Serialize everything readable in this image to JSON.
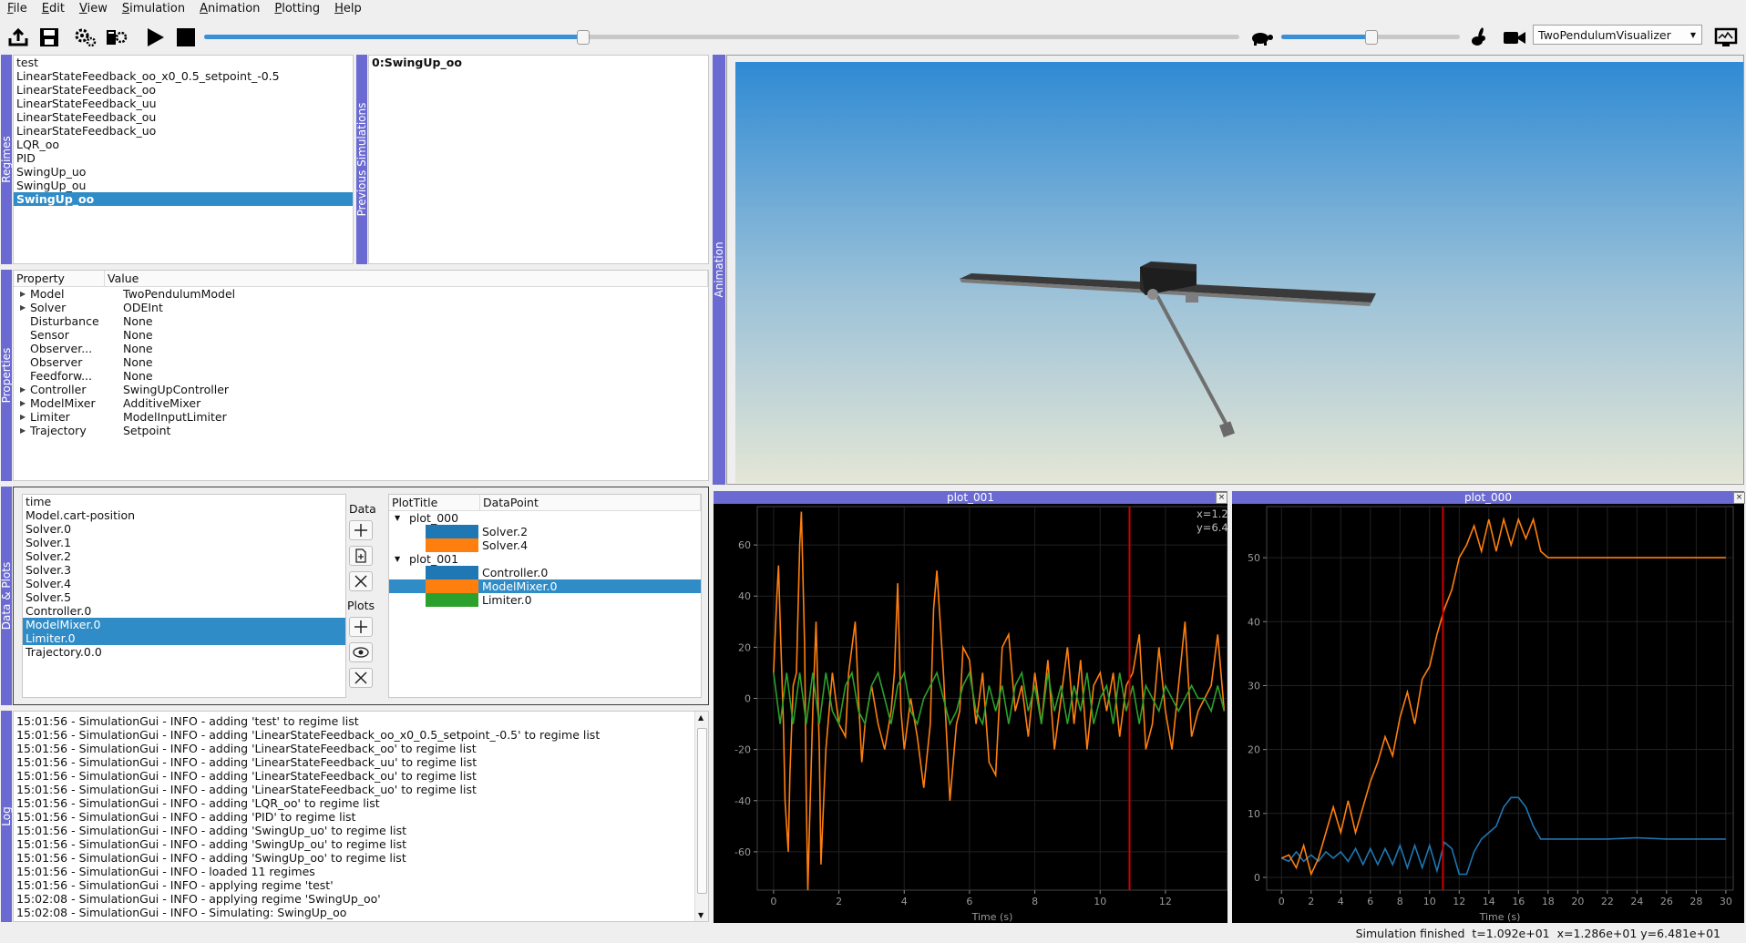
{
  "menu": [
    "File",
    "Edit",
    "View",
    "Simulation",
    "Animation",
    "Plotting",
    "Help"
  ],
  "toolbar": {
    "icons": [
      "upload-icon",
      "save-icon",
      "settings-icon",
      "batch-settings-icon",
      "play-icon",
      "stop-icon",
      "turtle-icon",
      "rabbit-icon",
      "camera-icon",
      "monitor-icon"
    ],
    "progress_fraction": 0.365,
    "speed_fraction": 0.5,
    "visualizer": "TwoPendulumVisualizer"
  },
  "docks": {
    "regimes": "Regimes",
    "previous": "Previous Simulations",
    "properties": "Properties",
    "data_plots": "Data & Plots",
    "log": "Log",
    "animation": "Animation"
  },
  "regimes": [
    "test",
    "LinearStateFeedback_oo_x0_0.5_setpoint_-0.5",
    "LinearStateFeedback_oo",
    "LinearStateFeedback_uu",
    "LinearStateFeedback_ou",
    "LinearStateFeedback_uo",
    "LQR_oo",
    "PID",
    "SwingUp_uo",
    "SwingUp_ou",
    "SwingUp_oo"
  ],
  "regimes_selected": 10,
  "previous_simulations": [
    "0:SwingUp_oo"
  ],
  "properties": {
    "headers": [
      "Property",
      "Value"
    ],
    "rows": [
      {
        "k": "Model",
        "v": "TwoPendulumModel",
        "exp": true
      },
      {
        "k": "Solver",
        "v": "ODEInt",
        "exp": true
      },
      {
        "k": "Disturbance",
        "v": "None",
        "exp": false
      },
      {
        "k": "Sensor",
        "v": "None",
        "exp": false
      },
      {
        "k": "Observer...",
        "v": "None",
        "exp": false
      },
      {
        "k": "Observer",
        "v": "None",
        "exp": false
      },
      {
        "k": "Feedforw...",
        "v": "None",
        "exp": false
      },
      {
        "k": "Controller",
        "v": "SwingUpController",
        "exp": true
      },
      {
        "k": "ModelMixer",
        "v": "AdditiveMixer",
        "exp": true
      },
      {
        "k": "Limiter",
        "v": "ModelInputLimiter",
        "exp": true
      },
      {
        "k": "Trajectory",
        "v": "Setpoint",
        "exp": true
      }
    ]
  },
  "data_list": [
    "time",
    "Model.cart-position",
    "Solver.0",
    "Solver.1",
    "Solver.2",
    "Solver.3",
    "Solver.4",
    "Solver.5",
    "Controller.0",
    "ModelMixer.0",
    "Limiter.0",
    "Trajectory.0.0"
  ],
  "data_selected": [
    9,
    10
  ],
  "side": {
    "data": "Data",
    "plots": "Plots"
  },
  "plot_tree": {
    "headers": [
      "PlotTitle",
      "DataPoint"
    ],
    "groups": [
      {
        "title": "plot_000",
        "items": [
          {
            "name": "Solver.2",
            "color": "#1f77b4"
          },
          {
            "name": "Solver.4",
            "color": "#ff7f0e"
          }
        ]
      },
      {
        "title": "plot_001",
        "items": [
          {
            "name": "Controller.0",
            "color": "#1f77b4"
          },
          {
            "name": "ModelMixer.0",
            "color": "#ff7f0e",
            "selected": true
          },
          {
            "name": "Limiter.0",
            "color": "#2ca02c"
          }
        ]
      }
    ]
  },
  "log": [
    "15:01:56 - SimulationGui - INFO - adding 'test' to regime list",
    "15:01:56 - SimulationGui - INFO - adding 'LinearStateFeedback_oo_x0_0.5_setpoint_-0.5' to regime list",
    "15:01:56 - SimulationGui - INFO - adding 'LinearStateFeedback_oo' to regime list",
    "15:01:56 - SimulationGui - INFO - adding 'LinearStateFeedback_uu' to regime list",
    "15:01:56 - SimulationGui - INFO - adding 'LinearStateFeedback_ou' to regime list",
    "15:01:56 - SimulationGui - INFO - adding 'LinearStateFeedback_uo' to regime list",
    "15:01:56 - SimulationGui - INFO - adding 'LQR_oo' to regime list",
    "15:01:56 - SimulationGui - INFO - adding 'PID' to regime list",
    "15:01:56 - SimulationGui - INFO - adding 'SwingUp_uo' to regime list",
    "15:01:56 - SimulationGui - INFO - adding 'SwingUp_ou' to regime list",
    "15:01:56 - SimulationGui - INFO - adding 'SwingUp_oo' to regime list",
    "15:01:56 - SimulationGui - INFO - loaded 11 regimes",
    "15:01:56 - SimulationGui - INFO - applying regime 'test'",
    "15:02:08 - SimulationGui - INFO - applying regime 'SwingUp_oo'",
    "15:02:08 - SimulationGui - INFO - Simulating: SwingUp_oo"
  ],
  "plots": {
    "p001": {
      "title": "plot_001",
      "coord_x": "x=1.2",
      "coord_y": "y=6.4"
    },
    "p000": {
      "title": "plot_000"
    }
  },
  "chart_data": [
    {
      "type": "line",
      "title": "plot_001",
      "xlabel": "Time (s)",
      "xlim": [
        -0.5,
        13.9
      ],
      "ylim": [
        -75,
        75
      ],
      "xticks": [
        0,
        2,
        4,
        6,
        8,
        10,
        12
      ],
      "yticks": [
        -60,
        -40,
        -20,
        0,
        20,
        40,
        60
      ],
      "cursor_x": 10.9,
      "series": [
        {
          "name": "ModelMixer.0",
          "color": "#ff7f0e",
          "x": [
            0,
            0.1,
            0.15,
            0.2,
            0.3,
            0.35,
            0.45,
            0.5,
            0.6,
            0.7,
            0.8,
            0.85,
            0.95,
            1.0,
            1.05,
            1.1,
            1.2,
            1.3,
            1.4,
            1.45,
            1.6,
            1.8,
            2.0,
            2.2,
            2.3,
            2.5,
            2.6,
            2.7,
            2.8,
            3.0,
            3.2,
            3.4,
            3.6,
            3.7,
            3.8,
            3.9,
            4.0,
            4.2,
            4.4,
            4.6,
            4.8,
            4.9,
            5.0,
            5.2,
            5.4,
            5.6,
            5.7,
            5.8,
            6.0,
            6.2,
            6.4,
            6.6,
            6.8,
            7.0,
            7.2,
            7.4,
            7.6,
            7.8,
            8.0,
            8.2,
            8.4,
            8.6,
            8.8,
            9.0,
            9.2,
            9.4,
            9.6,
            9.8,
            10.0,
            10.2,
            10.4,
            10.6,
            10.8,
            11.0,
            11.2,
            11.4,
            11.6,
            11.8,
            12.0,
            12.2,
            12.4,
            12.6,
            12.8,
            13.0,
            13.2,
            13.4,
            13.6,
            13.8
          ],
          "y": [
            10,
            40,
            52,
            30,
            -10,
            -40,
            -60,
            -30,
            5,
            10,
            60,
            73,
            20,
            -40,
            -75,
            -50,
            -5,
            30,
            -20,
            -65,
            -20,
            10,
            -10,
            -15,
            10,
            30,
            0,
            -25,
            -10,
            5,
            -10,
            -20,
            -5,
            10,
            45,
            -5,
            -20,
            0,
            -15,
            -35,
            -10,
            35,
            50,
            10,
            -40,
            -10,
            -5,
            20,
            15,
            -10,
            10,
            -25,
            -30,
            20,
            25,
            -5,
            5,
            -15,
            10,
            -10,
            15,
            -20,
            0,
            20,
            -10,
            15,
            -20,
            5,
            10,
            -5,
            10,
            -15,
            5,
            10,
            25,
            -20,
            -10,
            20,
            -5,
            -20,
            5,
            30,
            -15,
            -5,
            0,
            5,
            25,
            -5
          ]
        },
        {
          "name": "Limiter.0",
          "color": "#2ca02c",
          "x": [
            0,
            0.2,
            0.4,
            0.6,
            0.8,
            1.0,
            1.2,
            1.4,
            1.6,
            1.8,
            2.0,
            2.2,
            2.4,
            2.6,
            2.8,
            3.0,
            3.2,
            3.4,
            3.6,
            3.8,
            4.0,
            4.2,
            4.4,
            4.6,
            4.8,
            5.0,
            5.2,
            5.4,
            5.6,
            5.8,
            6.0,
            6.2,
            6.4,
            6.6,
            6.8,
            7.0,
            7.2,
            7.4,
            7.6,
            7.8,
            8.0,
            8.2,
            8.4,
            8.6,
            8.8,
            9.0,
            9.2,
            9.4,
            9.6,
            9.8,
            10.0,
            10.2,
            10.4,
            10.6,
            10.8,
            11.0,
            11.2,
            11.4,
            11.6,
            11.8,
            12.0,
            12.2,
            12.4,
            12.6,
            12.8,
            13.0,
            13.2,
            13.4,
            13.6,
            13.8
          ],
          "y": [
            10,
            -10,
            10,
            -10,
            10,
            -10,
            10,
            -10,
            10,
            -5,
            -10,
            5,
            10,
            -5,
            -10,
            5,
            10,
            0,
            -10,
            5,
            10,
            -5,
            -10,
            0,
            5,
            10,
            0,
            -10,
            -5,
            5,
            10,
            -5,
            -10,
            5,
            -5,
            5,
            -10,
            5,
            10,
            -5,
            5,
            -10,
            10,
            -5,
            5,
            -10,
            5,
            -5,
            10,
            -10,
            0,
            5,
            -10,
            10,
            -5,
            5,
            -10,
            5,
            0,
            -5,
            5,
            0,
            -5,
            0,
            5,
            0,
            0,
            -5,
            5,
            -5
          ]
        }
      ]
    },
    {
      "type": "line",
      "title": "plot_000",
      "xlabel": "Time (s)",
      "xlim": [
        -1,
        30.5
      ],
      "ylim": [
        -2,
        58
      ],
      "xticks": [
        0,
        2,
        4,
        6,
        8,
        10,
        12,
        14,
        16,
        18,
        20,
        22,
        24,
        26,
        28,
        30
      ],
      "yticks": [
        0,
        10,
        20,
        30,
        40,
        50
      ],
      "cursor_x": 10.9,
      "series": [
        {
          "name": "Solver.2",
          "color": "#1f77b4",
          "x": [
            0,
            0.5,
            1,
            1.5,
            2,
            2.5,
            3,
            3.5,
            4,
            4.5,
            5,
            5.5,
            6,
            6.5,
            7,
            7.5,
            8,
            8.5,
            9,
            9.5,
            10,
            10.5,
            11,
            11.5,
            12,
            12.5,
            13,
            13.5,
            14,
            14.5,
            15,
            15.5,
            16,
            16.5,
            17,
            17.5,
            18,
            19,
            20,
            22,
            24,
            26,
            28,
            30
          ],
          "y": [
            3,
            2.5,
            4,
            2.5,
            3.5,
            2.5,
            4,
            3,
            4,
            2.5,
            4.5,
            2,
            4.5,
            2,
            4.5,
            2,
            5,
            1.5,
            5,
            1.5,
            5,
            1,
            5.5,
            4.5,
            0.5,
            0.5,
            4,
            6,
            7,
            8,
            11,
            12.5,
            12.5,
            11,
            8,
            6,
            6,
            6,
            6,
            6,
            6.2,
            6,
            6,
            6
          ]
        },
        {
          "name": "Solver.4",
          "color": "#ff7f0e",
          "x": [
            0,
            0.5,
            1,
            1.5,
            2,
            2.5,
            3,
            3.5,
            4,
            4.5,
            5,
            5.5,
            6,
            6.5,
            7,
            7.5,
            8,
            8.5,
            9,
            9.5,
            10,
            10.5,
            11,
            11.5,
            12,
            12.5,
            13,
            13.5,
            14,
            14.5,
            15,
            15.5,
            16,
            16.5,
            17,
            17.5,
            18,
            19,
            20,
            22,
            24,
            26,
            28,
            30
          ],
          "y": [
            3,
            3.5,
            1.5,
            5,
            0.5,
            3,
            7,
            11,
            7,
            12,
            7,
            11,
            15,
            18,
            22,
            19,
            25,
            29,
            24,
            31,
            33,
            38,
            42,
            45,
            50,
            52,
            55,
            51,
            56,
            51,
            56,
            52,
            56,
            53,
            56,
            51,
            50,
            50,
            50,
            50,
            50,
            50,
            50,
            50
          ]
        }
      ]
    }
  ],
  "status": "Simulation finished  t=1.092e+01  x=1.286e+01 y=6.481e+01"
}
